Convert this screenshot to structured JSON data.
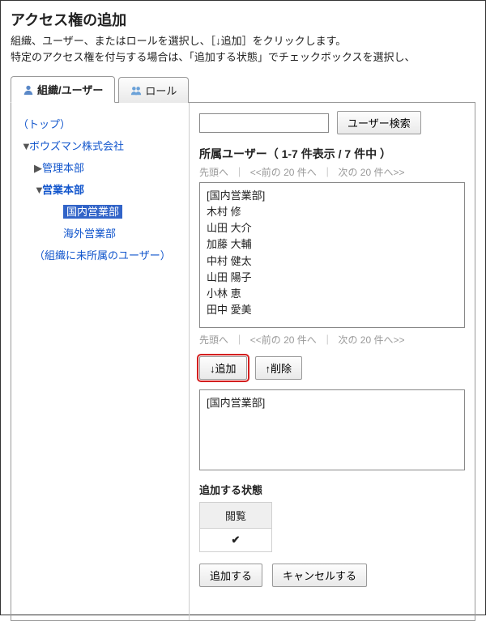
{
  "page": {
    "title": "アクセス権の追加",
    "description": "組織、ユーザー、またはロールを選択し、［↓追加］をクリックします。\n特定のアクセス権を付与する場合は、「追加する状態」でチェックボックスを選択し、"
  },
  "tabs": {
    "org_user": "組織/ユーザー",
    "role": "ロール"
  },
  "tree": {
    "top": "（トップ）",
    "company": "ボウズマン株式会社",
    "admin_dept": "管理本部",
    "sales_dept": "営業本部",
    "domestic_sales": "国内営業部",
    "overseas_sales": "海外営業部",
    "unassigned": "（組織に未所属のユーザー）"
  },
  "search": {
    "button": "ユーザー検索"
  },
  "user_list": {
    "title": "所属ユーザー（ 1-7 件表示 / 7 件中 ）",
    "pager_first": "先頭へ",
    "pager_prev": "<<前の 20 件へ",
    "pager_next": "次の 20 件へ>>",
    "items": [
      "[国内営業部]",
      "木村 修",
      "山田 大介",
      "加藤 大輔",
      "中村 健太",
      "山田 陽子",
      "小林 恵",
      "田中 愛美"
    ]
  },
  "buttons": {
    "add": "↓追加",
    "remove": "↑削除",
    "submit": "追加する",
    "cancel": "キャンセルする"
  },
  "selected": {
    "items": [
      "[国内営業部]"
    ]
  },
  "state": {
    "title": "追加する状態",
    "col_view": "閲覧",
    "checked": "✔"
  }
}
